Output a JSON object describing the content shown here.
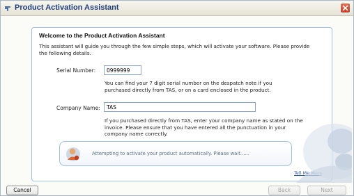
{
  "window": {
    "title": "Product Activation Assistant",
    "title_icon": "tas-logo-icon"
  },
  "content": {
    "heading": "Welcome to the Product Activation Assistant",
    "intro": "This assistant will guide you through the few simple steps, which will activate your software. Please provide the following details.",
    "serial": {
      "label": "Serial Number:",
      "value": "0999999",
      "help": "You can find your 7 digit serial number on the despatch note if you purchased directly from TAS, or on a card enclosed in the product."
    },
    "company": {
      "label": "Company Name:",
      "value": "TAS",
      "help": "If you purchased directly from TAS, enter your company name as stated on the invoice. Please ensure that you have entered all the punctuation in your company name correctly."
    },
    "status": {
      "icon": "user-person-icon",
      "text": "Attempting to activate your product automatically. Please wait......"
    },
    "tell_me_more": "Tell Me More"
  },
  "footer": {
    "cancel_label": "Cancel",
    "back_label": "Back",
    "next_label": "Next"
  },
  "colors": {
    "title_text": "#1f3d7a",
    "close_button": "#d04a2e",
    "card_border": "#9fbfe3",
    "link": "#2a5db0"
  }
}
